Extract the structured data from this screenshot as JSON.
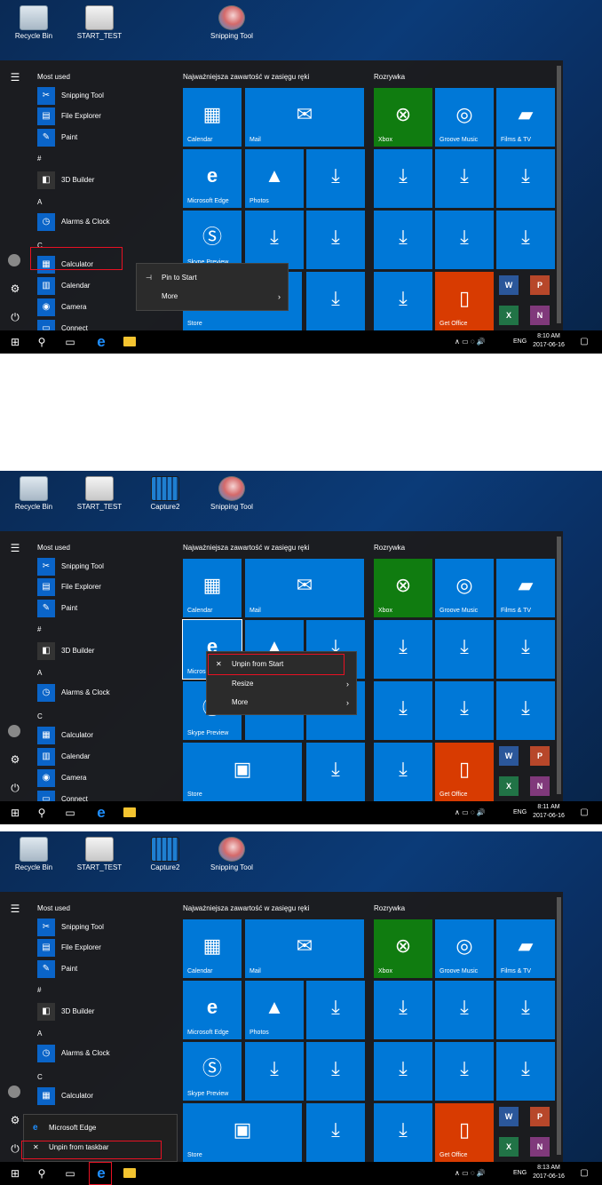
{
  "desktop": {
    "recycle_bin": "Recycle Bin",
    "start_test": "START_TEST",
    "capture2": "Capture2",
    "snipping_tool": "Snipping Tool"
  },
  "start": {
    "most_used": "Most used",
    "apps": {
      "snipping_tool": "Snipping Tool",
      "file_explorer": "File Explorer",
      "paint": "Paint",
      "builder": "3D Builder",
      "alarms": "Alarms & Clock",
      "calculator": "Calculator",
      "calendar": "Calendar",
      "camera": "Camera",
      "connect": "Connect"
    },
    "letters": {
      "hash": "#",
      "a": "A",
      "c": "C"
    },
    "groups": {
      "news": "Najważniejsza zawartość w zasięgu ręki",
      "play": "Rozrywka"
    },
    "tiles": {
      "calendar": "Calendar",
      "mail": "Mail",
      "xbox": "Xbox",
      "groove": "Groove Music",
      "films": "Films & TV",
      "edge": "Microsoft Edge",
      "photos": "Photos",
      "skype": "Skype Preview",
      "store": "Store",
      "office": "Get Office"
    },
    "office_minis": {
      "word": "W",
      "powerpoint": "P",
      "excel": "X",
      "onenote": "N"
    }
  },
  "menus": {
    "pin_to_start": "Pin to Start",
    "more": "More",
    "unpin_from_start": "Unpin from Start",
    "resize": "Resize",
    "jump_edge": "Microsoft Edge",
    "unpin_taskbar": "Unpin from taskbar"
  },
  "taskbar": {
    "lang": "ENG",
    "date": "2017-06-16",
    "time1": "8:10 AM",
    "time2": "8:11 AM",
    "time3": "8:13 AM"
  },
  "colors": {
    "tile_blue": "#0078d7",
    "xbox_green": "#107c10",
    "office_orange": "#d83b01",
    "highlight_red": "#e81123"
  }
}
